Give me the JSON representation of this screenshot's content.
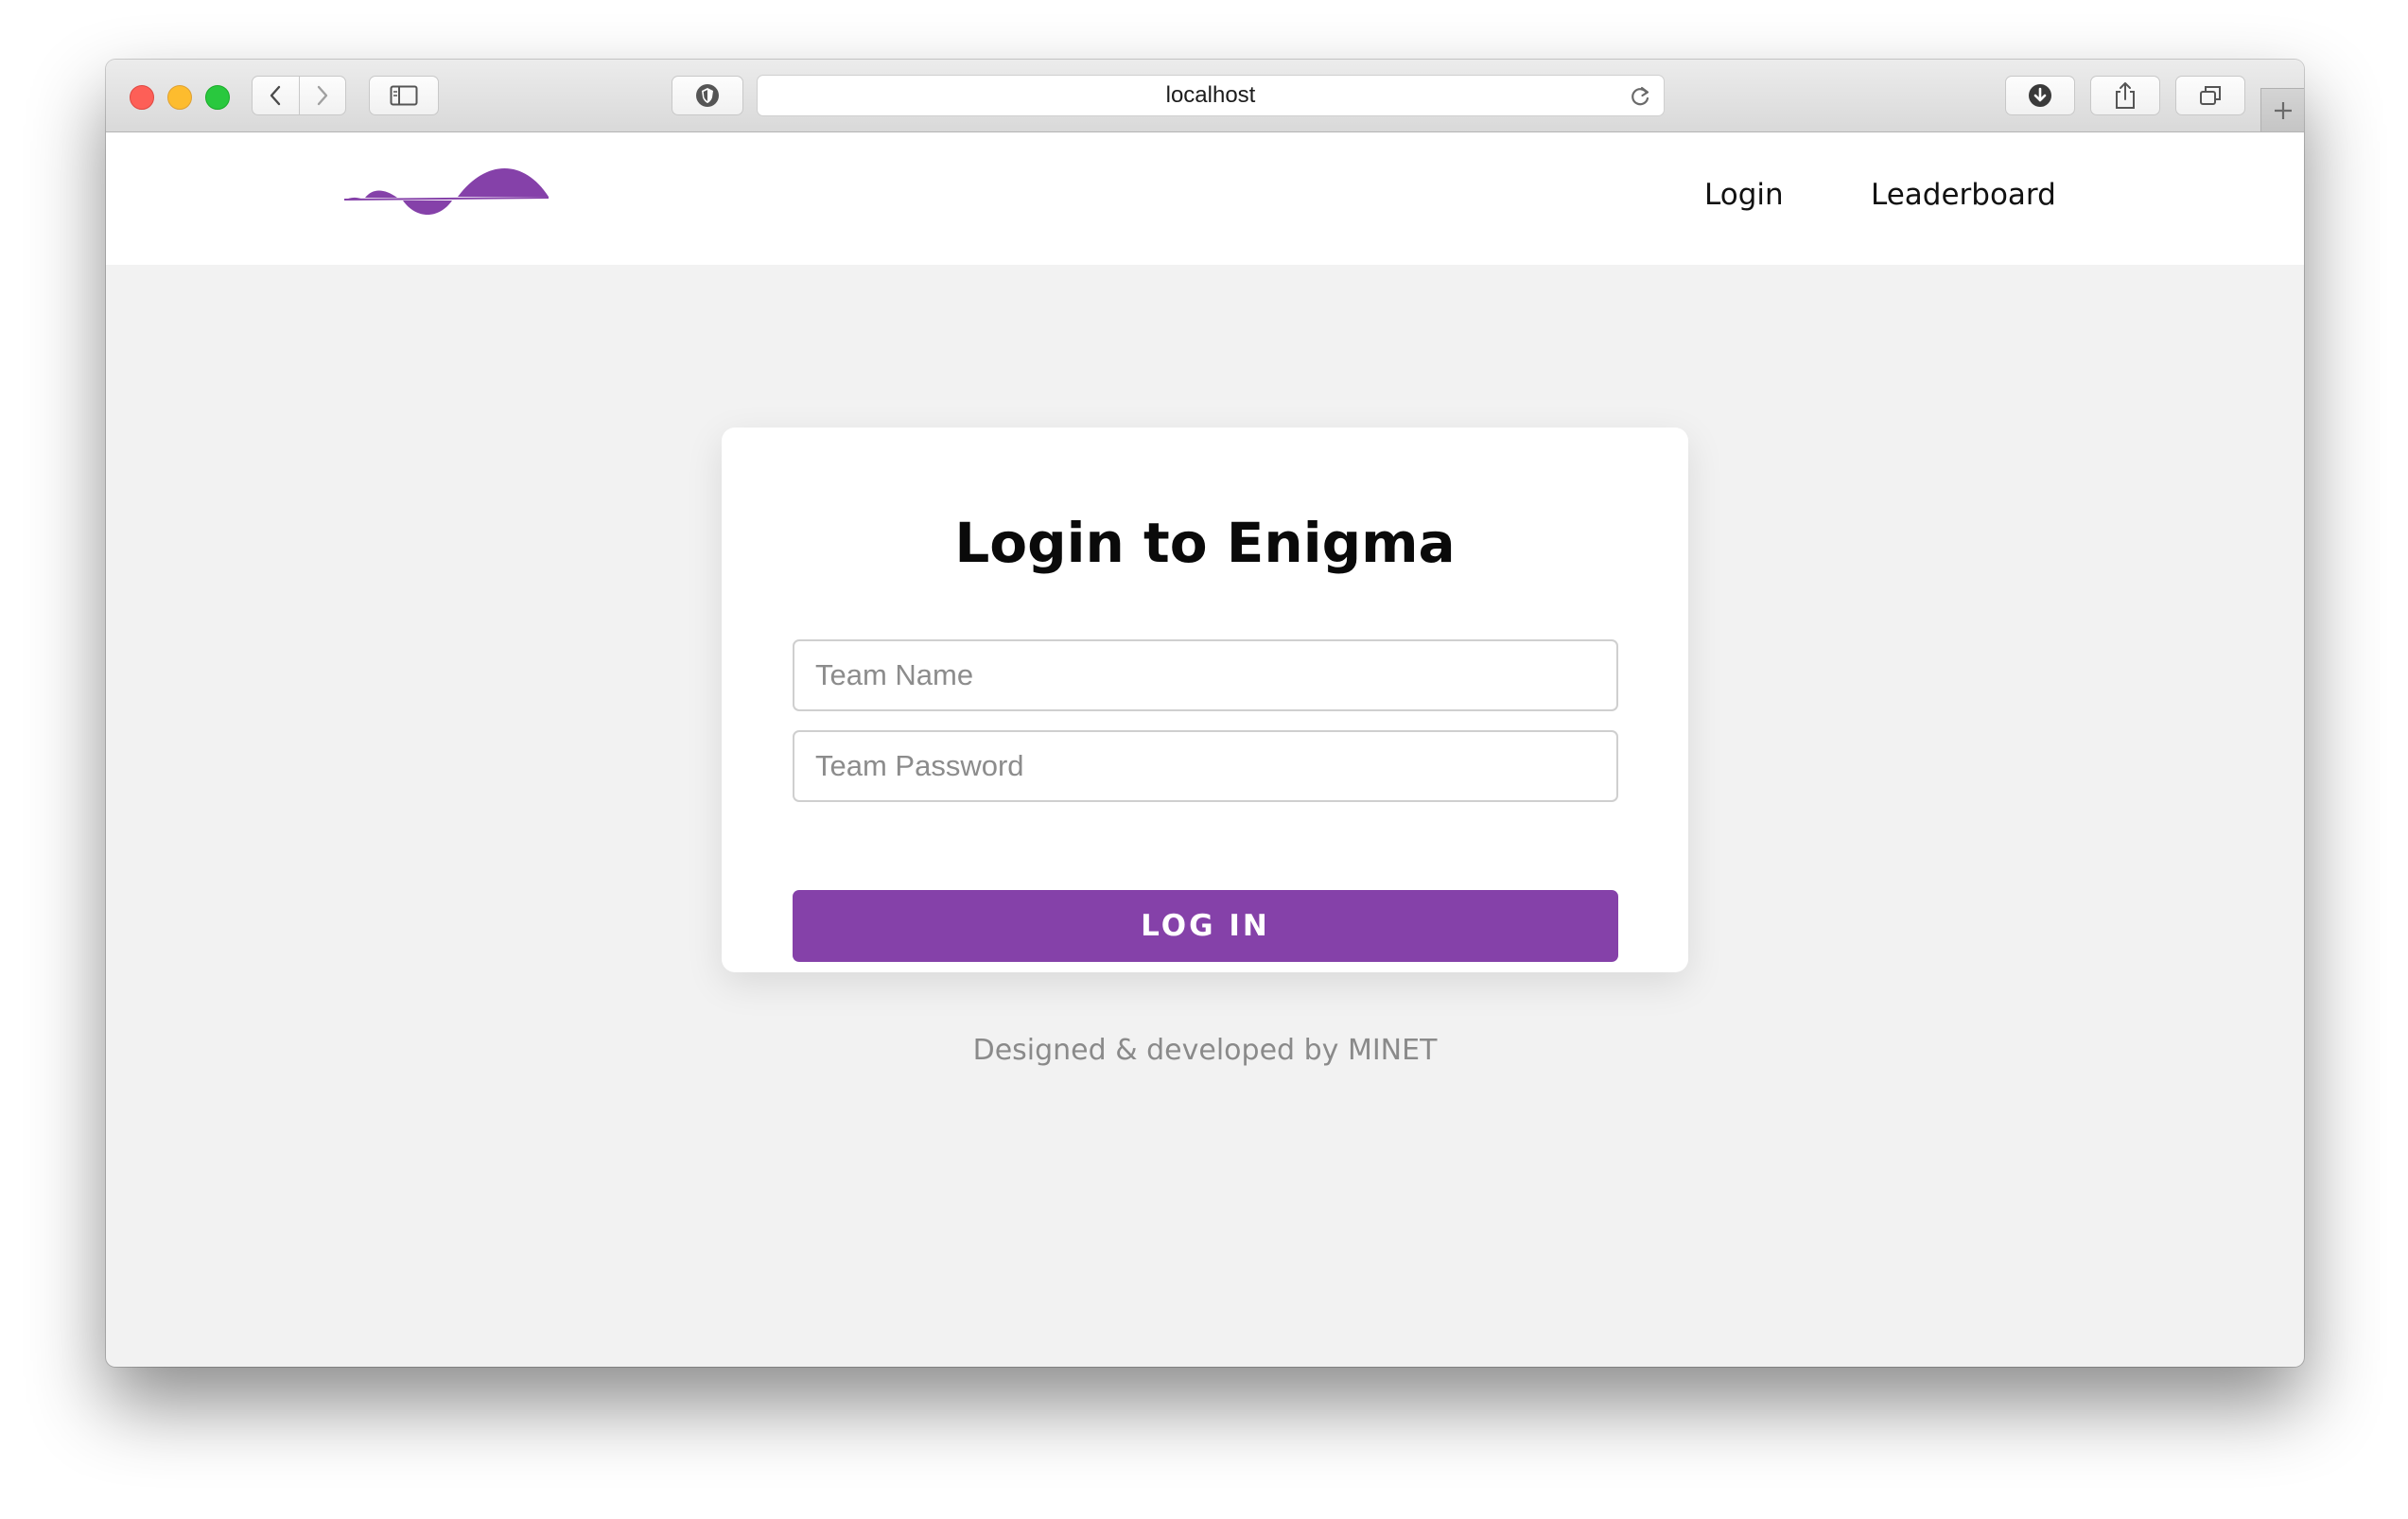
{
  "browser": {
    "address": "localhost",
    "icons": {
      "back": "chevron-left-icon",
      "forward": "chevron-right-icon",
      "sidebar": "sidebar-icon",
      "privacy": "shield-icon",
      "reload": "reload-icon",
      "downloads": "download-icon",
      "share": "share-icon",
      "tabs": "tabs-overview-icon",
      "new_tab": "plus-icon"
    }
  },
  "header": {
    "logo": "wave-logo",
    "nav": {
      "login": "Login",
      "leaderboard": "Leaderboard"
    }
  },
  "login_card": {
    "title": "Login to Enigma",
    "team_name_placeholder": "Team Name",
    "team_name_value": "",
    "team_password_placeholder": "Team Password",
    "team_password_value": "",
    "submit_label": "LOG IN"
  },
  "footer": {
    "credit": "Designed & developed by MINET"
  },
  "colors": {
    "accent": "#8541a9",
    "page_background": "#f2f2f2",
    "card_background": "#ffffff"
  }
}
